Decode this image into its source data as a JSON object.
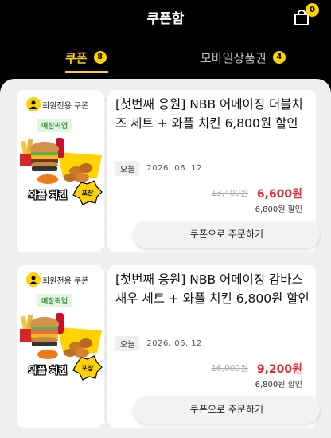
{
  "header": {
    "title": "쿠폰함",
    "cart_count": "0"
  },
  "tabs": [
    {
      "label": "쿠폰",
      "count": "8",
      "active": true
    },
    {
      "label": "모바일상품권",
      "count": "4",
      "active": false
    }
  ],
  "coupons": [
    {
      "member_label": "회원전용 쿠폰",
      "pickup_label": "매장픽업",
      "image_caption": "와플 치킨",
      "image_sticker": "포장",
      "title": "[첫번째 응원] NBB 어메이징 더블치즈 세트 + 와플 치킨 6,800원 할인",
      "today_label": "오늘",
      "expiry": "2026. 06. 12",
      "original_price": "13,400원",
      "sale_price": "6,600원",
      "discount": "6,800원 할인",
      "order_label": "쿠폰으로 주문하기"
    },
    {
      "member_label": "회원전용 쿠폰",
      "pickup_label": "매장픽업",
      "image_caption": "와플 치킨",
      "image_sticker": "포장",
      "title": "[첫번째 응원] NBB 어메이징 감바스 새우 세트 + 와플 치킨 6,800원 할인",
      "today_label": "오늘",
      "expiry": "2026. 06. 12",
      "original_price": "16,000원",
      "sale_price": "9,200원",
      "discount": "6,800원 할인",
      "order_label": "쿠폰으로 주문하기"
    }
  ],
  "colors": {
    "accent": "#ffd200",
    "sale": "#e8262c",
    "pickup": "#3c9a3c",
    "background": "#efefef"
  },
  "icons": {
    "cart": "cart-icon",
    "member": "member-icon"
  }
}
